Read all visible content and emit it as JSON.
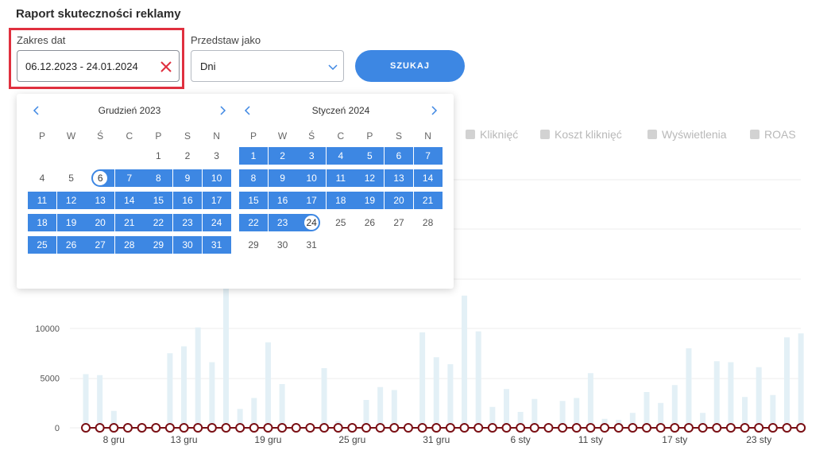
{
  "page_title": "Raport skuteczności reklamy",
  "filters": {
    "date_range_label": "Zakres dat",
    "date_range_value": "06.12.2023 - 24.01.2024",
    "display_as_label": "Przedstaw jako",
    "display_as_value": "Dni",
    "search_button": "SZUKAJ"
  },
  "legend": [
    "Kliknięć",
    "Koszt kliknięć",
    "Wyświetlenia",
    "ROAS"
  ],
  "calendar": {
    "weekdays": [
      "P",
      "W",
      "Ś",
      "C",
      "P",
      "S",
      "N"
    ],
    "months": [
      {
        "title": "Grudzień 2023",
        "days": 31,
        "start_weekday": 4,
        "range_start": 6,
        "range_end": 31,
        "highlight": 6
      },
      {
        "title": "Styczeń 2024",
        "days": 31,
        "start_weekday": 0,
        "range_start": 1,
        "range_end": 24,
        "highlight": 24
      }
    ]
  },
  "chart_data": {
    "type": "bar",
    "y_ticks": [
      0,
      5000,
      10000
    ],
    "x_tick_labels": [
      "8 gru",
      "13 gru",
      "19 gru",
      "25 gru",
      "31 gru",
      "6 sty",
      "11 sty",
      "17 sty",
      "23 sty"
    ],
    "x_tick_days": [
      2,
      7,
      13,
      19,
      25,
      31,
      36,
      42,
      48
    ],
    "bar_values": [
      5400,
      5300,
      1700,
      200,
      100,
      100,
      7500,
      8200,
      10100,
      6600,
      15000,
      1900,
      3000,
      8600,
      4400,
      200,
      100,
      6000,
      700,
      200,
      2800,
      4100,
      3800,
      100,
      9600,
      7100,
      6400,
      13300,
      9700,
      2100,
      3900,
      1600,
      2900,
      200,
      2700,
      3000,
      5500,
      900,
      800,
      1500,
      3600,
      2500,
      4300,
      8000,
      1500,
      6700,
      6600,
      3100,
      6100,
      3300,
      9100,
      9500
    ],
    "line_values": [
      0,
      0,
      0,
      0,
      0,
      0,
      0,
      0,
      0,
      0,
      0,
      0,
      0,
      0,
      0,
      0,
      0,
      0,
      0,
      0,
      0,
      0,
      0,
      0,
      0,
      0,
      0,
      0,
      0,
      0,
      0,
      0,
      0,
      0,
      0,
      0,
      0,
      0,
      0,
      0,
      0,
      0,
      0,
      0,
      0,
      0,
      0,
      0,
      0,
      0,
      0,
      0
    ],
    "bar_color": "#e3f0f6",
    "line_color": "#7a0f14"
  }
}
